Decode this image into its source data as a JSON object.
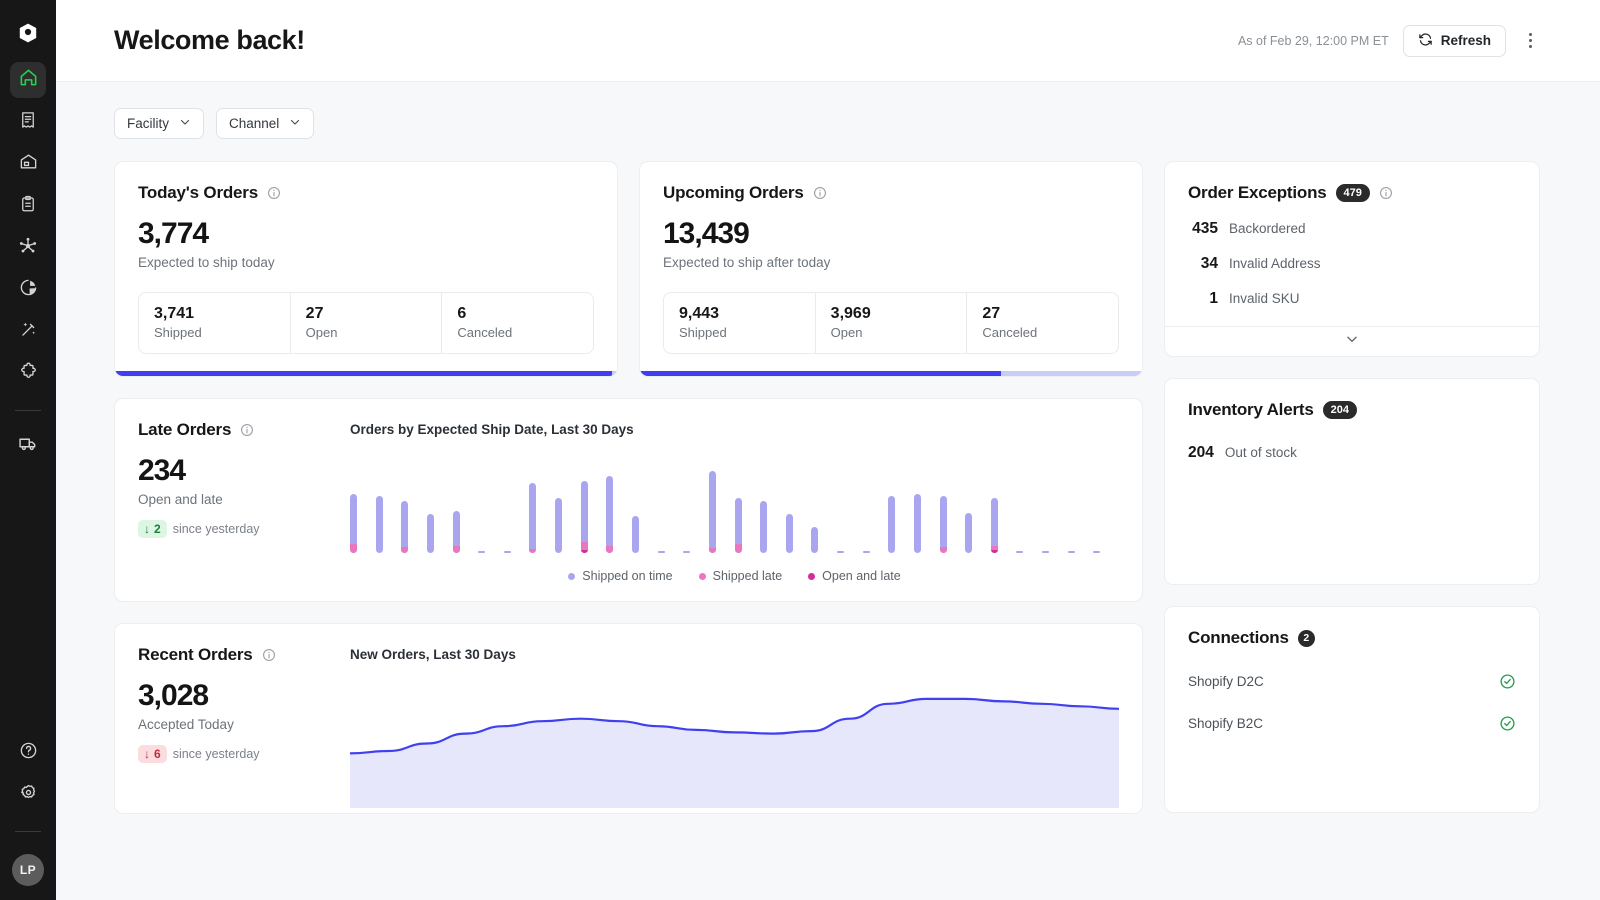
{
  "sidebar": {
    "logo": "hexagon-logo",
    "items": [
      {
        "name": "home",
        "icon": "home-icon",
        "active": true
      },
      {
        "name": "orders",
        "icon": "receipt-icon",
        "active": false
      },
      {
        "name": "warehouse",
        "icon": "warehouse-icon",
        "active": false
      },
      {
        "name": "tasks",
        "icon": "clipboard-icon",
        "active": false
      },
      {
        "name": "network",
        "icon": "network-nodes-icon",
        "active": false
      },
      {
        "name": "analytics",
        "icon": "pie-chart-icon",
        "active": false
      },
      {
        "name": "automation",
        "icon": "magic-wand-icon",
        "active": false
      },
      {
        "name": "integrations",
        "icon": "puzzle-piece-icon",
        "active": false
      },
      {
        "name": "shipping",
        "icon": "truck-icon",
        "active": false
      }
    ],
    "bottom_items": [
      {
        "name": "help",
        "icon": "question-circle-icon"
      },
      {
        "name": "settings",
        "icon": "gear-icon"
      }
    ],
    "avatar_initials": "LP"
  },
  "header": {
    "title": "Welcome back!",
    "as_of": "As of Feb 29, 12:00 PM ET",
    "refresh_label": "Refresh",
    "refresh_icon": "refresh-icon",
    "overflow_icon": "kebab-menu-icon"
  },
  "filters": [
    {
      "label": "Facility",
      "icon": "chevron-down-icon"
    },
    {
      "label": "Channel",
      "icon": "chevron-down-icon"
    }
  ],
  "todays_orders": {
    "title": "Today's Orders",
    "info_icon": "info-icon",
    "value": "3,774",
    "sub": "Expected to ship today",
    "stats": [
      {
        "value": "3,741",
        "label": "Shipped"
      },
      {
        "value": "27",
        "label": "Open"
      },
      {
        "value": "6",
        "label": "Canceled"
      }
    ],
    "progress_percent": 99,
    "progress_color": "#3f3ef0",
    "progress_track": "#c8cdf5"
  },
  "upcoming_orders": {
    "title": "Upcoming Orders",
    "info_icon": "info-icon",
    "value": "13,439",
    "sub": "Expected to ship after today",
    "stats": [
      {
        "value": "9,443",
        "label": "Shipped"
      },
      {
        "value": "3,969",
        "label": "Open"
      },
      {
        "value": "27",
        "label": "Canceled"
      }
    ],
    "progress_percent": 72,
    "progress_color": "#3f3ef0",
    "progress_track": "#c8cdf5"
  },
  "order_exceptions": {
    "title": "Order Exceptions",
    "badge": "479",
    "info_icon": "info-icon",
    "rows": [
      {
        "count": "435",
        "label": "Backordered"
      },
      {
        "count": "34",
        "label": "Invalid Address"
      },
      {
        "count": "1",
        "label": "Invalid SKU"
      }
    ],
    "expand_icon": "chevron-down-icon"
  },
  "late_orders": {
    "title": "Late Orders",
    "info_icon": "info-icon",
    "value": "234",
    "sub": "Open and late",
    "delta_icon": "arrow-down-icon",
    "delta_value": "2",
    "delta_note": "since yesterday",
    "delta_tone": "good",
    "chart_title": "Orders by Expected Ship Date, Last 30 Days"
  },
  "inventory_alerts": {
    "title": "Inventory Alerts",
    "badge": "204",
    "rows": [
      {
        "count": "204",
        "label": "Out of stock"
      }
    ]
  },
  "recent_orders": {
    "title": "Recent Orders",
    "info_icon": "info-icon",
    "value": "3,028",
    "sub": "Accepted Today",
    "delta_icon": "arrow-down-icon",
    "delta_value": "6",
    "delta_note": "since yesterday",
    "delta_tone": "bad",
    "chart_title": "New Orders, Last 30 Days"
  },
  "connections": {
    "title": "Connections",
    "badge": "2",
    "rows": [
      {
        "name": "Shopify D2C",
        "status": "connected",
        "status_icon": "check-circle-icon"
      },
      {
        "name": "Shopify B2C",
        "status": "connected",
        "status_icon": "check-circle-icon"
      }
    ]
  },
  "chart_data": [
    {
      "type": "bar",
      "id": "orders-by-expected-ship-date",
      "title": "Orders by Expected Ship Date, Last 30 Days",
      "stacked": true,
      "grid": false,
      "legend_position": "bottom",
      "xlabel": "",
      "ylabel": "",
      "ylim": [
        0,
        100
      ],
      "categories": [
        "1",
        "2",
        "3",
        "4",
        "5",
        "6",
        "7",
        "8",
        "9",
        "10",
        "11",
        "12",
        "13",
        "14",
        "15",
        "16",
        "17",
        "18",
        "19",
        "20",
        "21",
        "22",
        "23",
        "24",
        "25",
        "26",
        "27",
        "28",
        "29",
        "30"
      ],
      "series": [
        {
          "name": "Shipped on time",
          "color": "#a9a6ef",
          "values": [
            54,
            62,
            50,
            42,
            38,
            2,
            1,
            72,
            60,
            66,
            76,
            40,
            1,
            1,
            84,
            50,
            56,
            42,
            28,
            1,
            1,
            62,
            64,
            56,
            44,
            52,
            1,
            1,
            1,
            1
          ]
        },
        {
          "name": "Shipped late",
          "color": "#e977c0",
          "values": [
            10,
            0,
            6,
            0,
            8,
            0,
            0,
            4,
            0,
            9,
            8,
            0,
            0,
            0,
            5,
            10,
            0,
            0,
            0,
            0,
            0,
            0,
            0,
            6,
            0,
            5,
            0,
            0,
            0,
            0
          ]
        },
        {
          "name": "Open and late",
          "color": "#d62a9d",
          "values": [
            0,
            0,
            0,
            0,
            0,
            0,
            0,
            0,
            0,
            3,
            0,
            0,
            0,
            0,
            0,
            0,
            0,
            0,
            0,
            0,
            0,
            0,
            0,
            0,
            0,
            3,
            0,
            0,
            0,
            0
          ]
        }
      ]
    },
    {
      "type": "area",
      "id": "new-orders-last-30-days",
      "title": "New Orders, Last 30 Days",
      "grid": false,
      "legend_position": "none",
      "xlabel": "",
      "ylabel": "",
      "line_color": "#4040ef",
      "fill_color": "#e7e7fb",
      "ylim": [
        0,
        100
      ],
      "x": [
        0,
        1,
        2,
        3,
        4,
        5,
        6,
        7,
        8,
        9,
        10,
        11,
        12,
        13,
        14,
        15,
        16,
        17,
        18,
        19,
        20
      ],
      "values": [
        44,
        46,
        52,
        60,
        66,
        70,
        72,
        70,
        66,
        63,
        61,
        60,
        62,
        72,
        84,
        88,
        88,
        86,
        84,
        82,
        80
      ]
    }
  ]
}
